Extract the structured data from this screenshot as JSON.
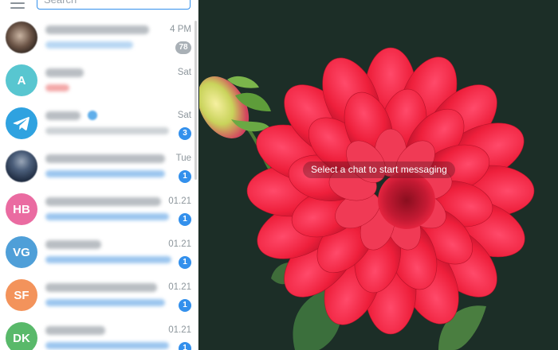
{
  "search": {
    "placeholder": "Search"
  },
  "chats": [
    {
      "time": "4 PM",
      "badge": "78",
      "badge_style": "muted"
    },
    {
      "avatar_initials": "A",
      "avatar_color": "#58c6d0",
      "time": "Sat"
    },
    {
      "avatar_icon": "telegram-logo-icon",
      "avatar_color": "#2fa2e0",
      "time": "Sat",
      "badge": "3",
      "badge_style": "unread"
    },
    {
      "time": "Tue",
      "badge": "1",
      "badge_style": "unread"
    },
    {
      "avatar_initials": "HB",
      "avatar_color": "#ea6ba1",
      "time": "01.21",
      "badge": "1",
      "badge_style": "unread"
    },
    {
      "avatar_initials": "VG",
      "avatar_color": "#4f9fd8",
      "time": "01.21",
      "badge": "1",
      "badge_style": "unread"
    },
    {
      "avatar_initials": "SF",
      "avatar_color": "#f3935b",
      "time": "01.21",
      "badge": "1",
      "badge_style": "unread"
    },
    {
      "avatar_initials": "DK",
      "avatar_color": "#59b96a",
      "time": "01.21",
      "badge": "1",
      "badge_style": "unread"
    }
  ],
  "main": {
    "empty_state": "Select a chat to start messaging",
    "background_color": "#1c2e27"
  },
  "colors": {
    "accent": "#3390ec",
    "muted_badge": "#a9b0b6"
  }
}
